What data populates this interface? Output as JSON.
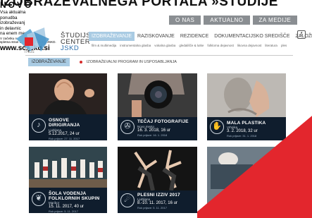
{
  "headline": "IZOBRAŽEVALNEGA PORTALA »ŠTUDIJE",
  "top_nav": [
    "O NAS",
    "AKTUALNO",
    "ZA MEDIJE"
  ],
  "brand": {
    "line1": "ŠTUDIJSKI",
    "line2": "CENTER",
    "line3": "JSKD",
    "logo_text": "ITEJS"
  },
  "main_nav": [
    "IZOBRAŽEVANJE",
    "RAZISKOVANJE",
    "REZIDENCE",
    "DOKUMENTACIJSKO SREDIŠČE",
    "ZALOŽNIŠTVO"
  ],
  "sub_nav": [
    "film & multimedija",
    "instrumentalna glasba",
    "vokalna glasba",
    "gledališče & lutke",
    "folklorna dejavnost",
    "likovna dejavnost",
    "literatura",
    "ples"
  ],
  "breadcrumb": {
    "section": "IZOBRAŽEVANJE",
    "page": "IZOBRAŽEVALNI PROGRAM IN USPOSABLJANJA"
  },
  "cards": [
    {
      "title1": "OSNOVE",
      "title2": "DIRIGIRANJA",
      "place": "Ljubljana",
      "date": "5.12.2017, 24 ur",
      "reg": "Rok prijave: 27. 11. 2017"
    },
    {
      "title1": "TEČAJ FOTOGRAFIJE",
      "title2": "",
      "place": "Novo mesto",
      "date": "16. 3. 2018, 16 ur",
      "reg": "Rok prijave: 16. 1. 2018"
    },
    {
      "title1": "MALA PLASTIKA",
      "title2": "",
      "place": "Vrhnika",
      "date": "3. 2. 2018, 32 ur",
      "reg": "Rok prijave: 31. 1. 2018"
    },
    {
      "title1": "ŠOLA VODENJA",
      "title2": "FOLKLORNIH SKUPIN",
      "place": "Maribor",
      "date": "15. 11. 2017, 40 ur",
      "reg": "Rok prijave: 5. 11. 2017"
    },
    {
      "title1": "PLESNI IZZIV 2017",
      "title2": "",
      "place": "Ljubljana",
      "date": "8.-10. 11. 2017, 16 ur",
      "reg": "Rok prijave: 5. 11. 2017"
    }
  ],
  "promo": {
    "novo": "NOVO",
    "line1": "Vsa aktualna",
    "line2": "ponudba",
    "line3": "izobraževanj",
    "line4": "in delavnic",
    "line5": "na enem mestu.",
    "foot1": "V začetku novembra nova",
    "foot2": "spletna stran Študijskega centra JSKD.",
    "url": "www.sc.jskd.si"
  },
  "colors": {
    "accent": "#a9cbe3",
    "promo": "#e3262d",
    "card": "#0f1d2d",
    "nav_gray": "#8a8e92"
  }
}
